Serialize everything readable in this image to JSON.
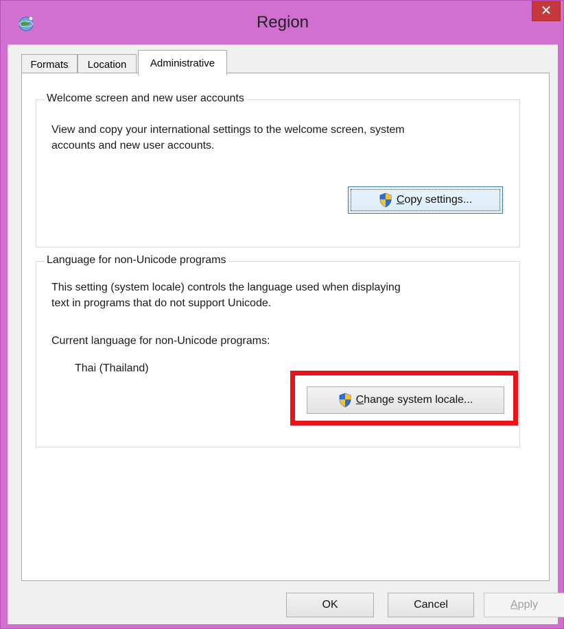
{
  "window": {
    "title": "Region",
    "close_label": "✕",
    "icon": "globe-icon"
  },
  "tabs": [
    {
      "label": "Formats",
      "active": false
    },
    {
      "label": "Location",
      "active": false
    },
    {
      "label": "Administrative",
      "active": true
    }
  ],
  "welcome_group": {
    "legend": "Welcome screen and new user accounts",
    "description_line1": "View and copy your international settings to the welcome screen, system",
    "description_line2": "accounts and new user accounts.",
    "button_label_accel": "C",
    "button_label_rest": "opy settings...",
    "button_icon": "uac-shield-icon"
  },
  "locale_group": {
    "legend": "Language for non-Unicode programs",
    "description_line1": "This setting (system locale) controls the language used when displaying",
    "description_line2": "text in programs that do not support Unicode.",
    "current_label": "Current language for non-Unicode programs:",
    "current_value": "Thai (Thailand)",
    "button_label_accel": "C",
    "button_label_rest": "hange system locale...",
    "button_icon": "uac-shield-icon"
  },
  "footer": {
    "ok_label": "OK",
    "cancel_label": "Cancel",
    "apply_label_accel": "A",
    "apply_label_rest": "pply"
  },
  "colors": {
    "titlebar": "#d170d1",
    "close_button": "#c7383d",
    "highlight_box": "#e8141a"
  }
}
